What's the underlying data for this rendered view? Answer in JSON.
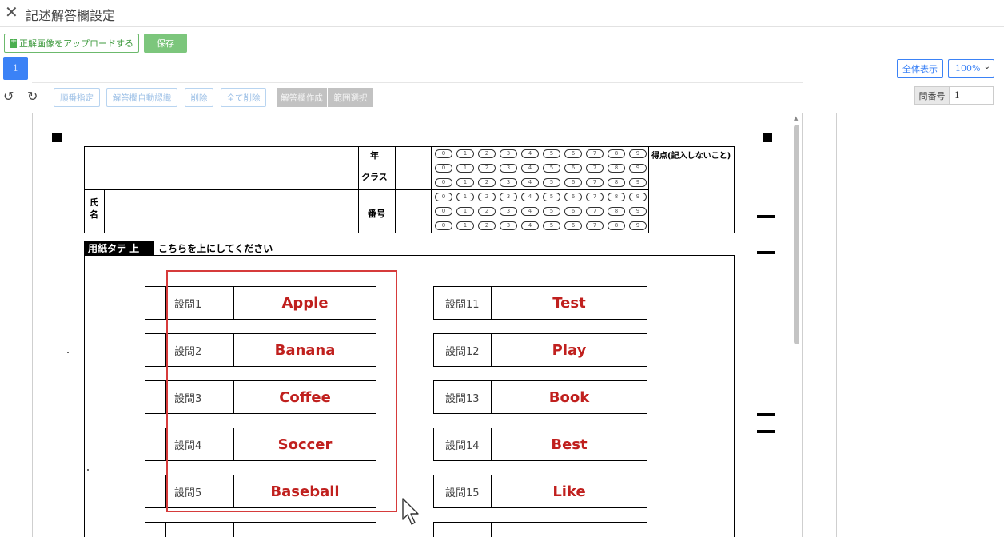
{
  "window": {
    "title": "記述解答欄設定"
  },
  "toolbar": {
    "upload_label": "正解画像をアップロードする",
    "save_label": "保存",
    "tab_label": "1",
    "show_all_label": "全体表示",
    "zoom_value": "100%",
    "order_label": "順番指定",
    "auto_detect_label": "解答欄自動認識",
    "delete_label": "削除",
    "delete_all_label": "全て削除",
    "create_field_label": "解答欄作成",
    "range_select_label": "範囲選択",
    "question_number_label": "問番号",
    "question_number_value": "1"
  },
  "sheet": {
    "header": {
      "year": "年",
      "class": "クラス",
      "number": "番号",
      "name": "氏名",
      "score": "得点(記入しないこと)"
    },
    "orientation_label": "用紙タテ 上",
    "orientation_text": "こちらを上にしてください",
    "bubble_digits": [
      "0",
      "1",
      "2",
      "3",
      "4",
      "5",
      "6",
      "7",
      "8",
      "9"
    ],
    "left_questions": [
      {
        "label": "設問1",
        "answer": "Apple"
      },
      {
        "label": "設問2",
        "answer": "Banana"
      },
      {
        "label": "設問3",
        "answer": "Coffee"
      },
      {
        "label": "設問4",
        "answer": "Soccer"
      },
      {
        "label": "設問5",
        "answer": "Baseball"
      }
    ],
    "right_questions": [
      {
        "label": "設問11",
        "answer": "Test"
      },
      {
        "label": "設問12",
        "answer": "Play"
      },
      {
        "label": "設問13",
        "answer": "Book"
      },
      {
        "label": "設問14",
        "answer": "Best"
      },
      {
        "label": "設問15",
        "answer": "Like"
      }
    ]
  },
  "colors": {
    "accent": "#3b82f6",
    "save": "#7cc67c",
    "answer": "#c0201e",
    "selection": "#d63b3b"
  }
}
